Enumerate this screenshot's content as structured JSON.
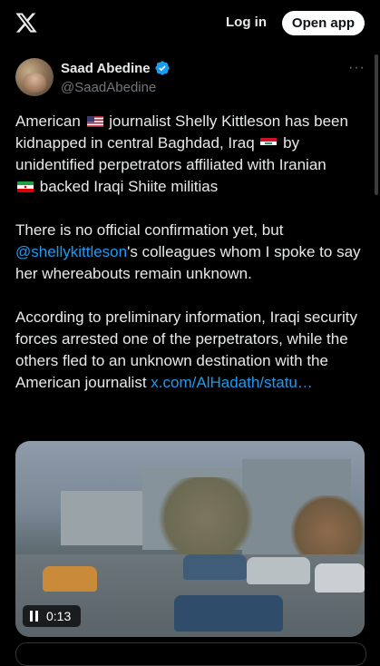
{
  "header": {
    "logo_icon": "x-logo-icon",
    "login_label": "Log in",
    "open_app_label": "Open app"
  },
  "author": {
    "name": "Saad Abedine",
    "handle": "@SaadAbedine",
    "verified_icon": "verified-badge-icon"
  },
  "tweet": {
    "p1": {
      "t1": "American",
      "t2": "journalist Shelly Kittleson has been kidnapped in central Baghdad, Iraq",
      "t3": "by unidentified perpetrators affiliated with Iranian",
      "t4": "backed Iraqi Shiite militias"
    },
    "p2": {
      "t1": "There is no official confirmation yet, but",
      "mention": "@shellykittleson",
      "t2": "'s colleagues whom I spoke to say her whereabouts remain unknown."
    },
    "p3": {
      "t1": "According to preliminary information, Iraqi security forces arrested one of the perpetrators, while the others fled to an unknown destination with the American journalist",
      "link": "x.com/AlHadath/statu…"
    }
  },
  "media": {
    "duration": "0:13"
  },
  "colors": {
    "accent": "#1d9bf0",
    "background": "#000000",
    "text": "#e7e9ea",
    "secondary_text": "#71767b"
  }
}
